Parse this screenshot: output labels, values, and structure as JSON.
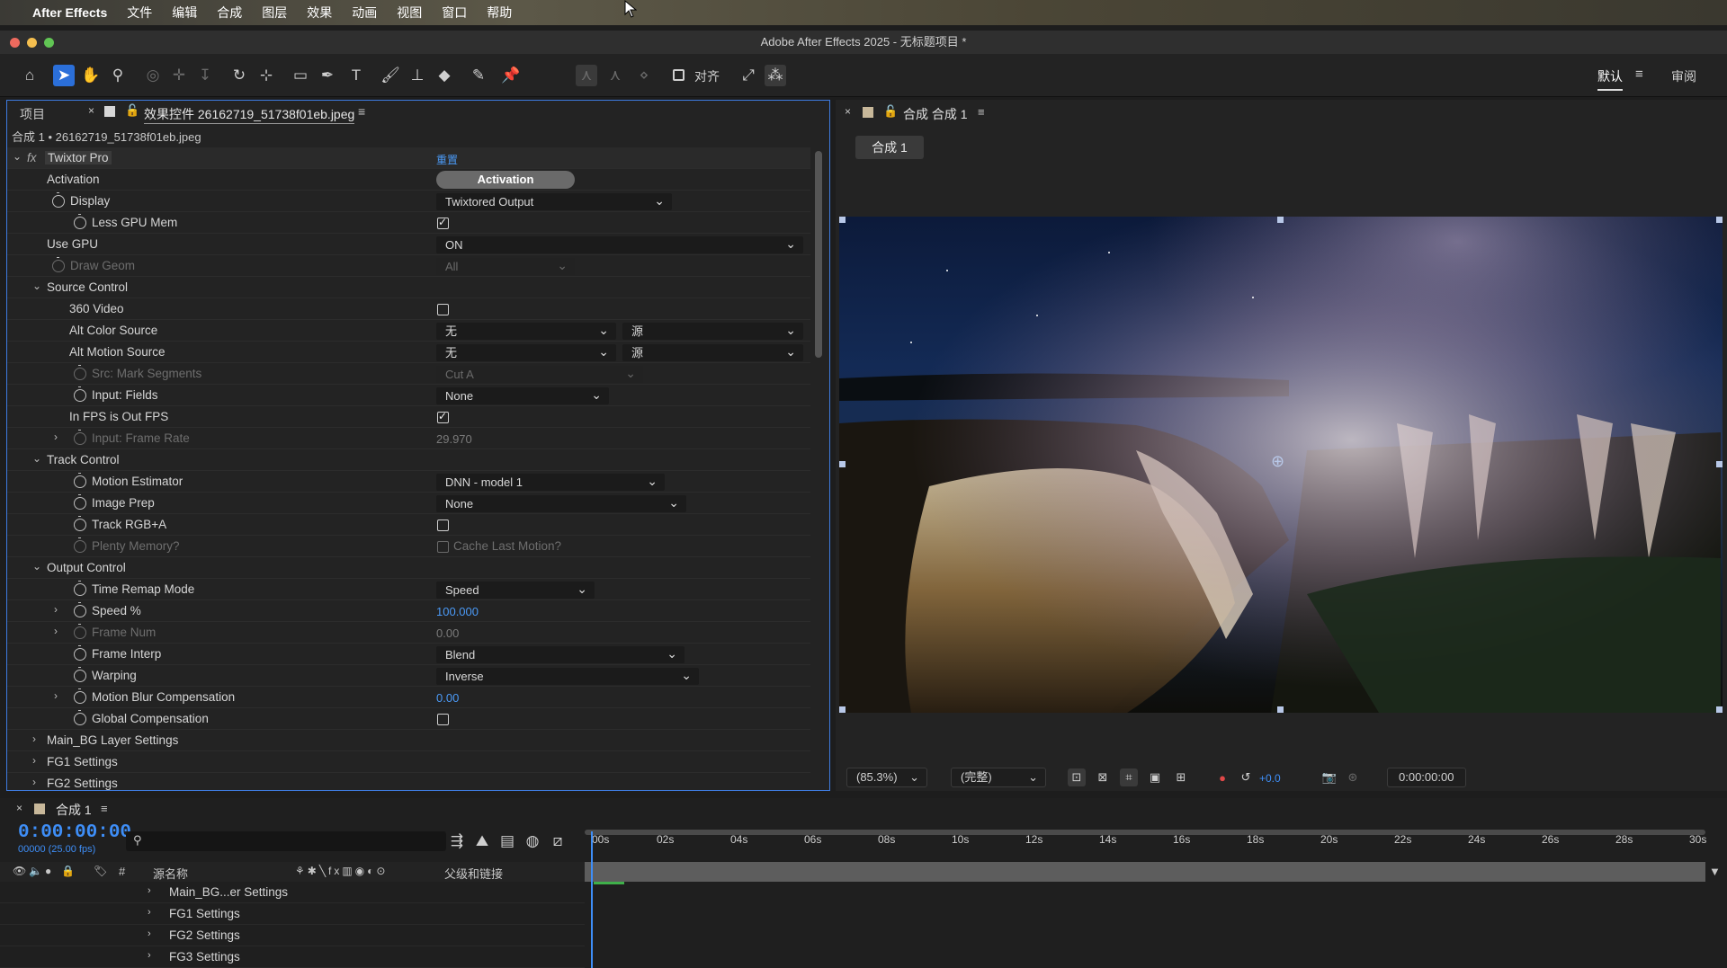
{
  "menubar": {
    "app": "After Effects",
    "items": [
      "文件",
      "编辑",
      "合成",
      "图层",
      "效果",
      "动画",
      "视图",
      "窗口",
      "帮助"
    ]
  },
  "titlebar": {
    "title": "Adobe After Effects 2025 - 无标题项目 *"
  },
  "toolbar": {
    "align_label": "对齐",
    "workspace_default": "默认",
    "workspace_review": "审阅"
  },
  "effect_controls": {
    "tab_project": "项目",
    "tab_effects": "效果控件 26162719_51738f01eb.jpeg",
    "subhead": "合成 1 • 26162719_51738f01eb.jpeg",
    "effect_name": "Twixtor Pro",
    "reset": "重置",
    "activation_label": "Activation",
    "activation_button": "Activation",
    "rows": {
      "display": "Display",
      "display_val": "Twixtored Output",
      "less_gpu": "Less GPU Mem",
      "use_gpu": "Use GPU",
      "use_gpu_val": "ON",
      "draw_geom": "Draw Geom",
      "draw_geom_val": "All",
      "source_control": "Source Control",
      "video360": "360 Video",
      "alt_color": "Alt Color Source",
      "alt_color_a": "无",
      "alt_color_b": "源",
      "alt_motion": "Alt Motion Source",
      "alt_motion_a": "无",
      "alt_motion_b": "源",
      "src_mark": "Src: Mark Segments",
      "src_mark_val": "Cut A",
      "input_fields": "Input: Fields",
      "input_fields_val": "None",
      "in_fps": "In FPS is Out FPS",
      "input_rate": "Input: Frame Rate",
      "input_rate_val": "29.970",
      "track_control": "Track Control",
      "motion_est": "Motion Estimator",
      "motion_est_val": "DNN - model 1",
      "image_prep": "Image Prep",
      "image_prep_val": "None",
      "track_rgba": "Track RGB+A",
      "plenty_mem": "Plenty Memory?",
      "cache_last": "Cache Last Motion?",
      "output_control": "Output Control",
      "time_remap": "Time Remap Mode",
      "time_remap_val": "Speed",
      "speed": "Speed %",
      "speed_val": "100.000",
      "frame_num": "Frame Num",
      "frame_num_val": "0.00",
      "frame_interp": "Frame Interp",
      "frame_interp_val": "Blend",
      "warping": "Warping",
      "warping_val": "Inverse",
      "mbc": "Motion Blur Compensation",
      "mbc_val": "0.00",
      "global_comp": "Global Compensation",
      "main_bg": "Main_BG Layer Settings",
      "fg1": "FG1 Settings",
      "fg2": "FG2 Settings"
    }
  },
  "composition": {
    "tab": "合成 合成 1",
    "chip": "合成 1",
    "zoom": "(85.3%)",
    "quality": "(完整)",
    "exposure": "+0.0",
    "timecode": "0:00:00:00"
  },
  "timeline": {
    "tab": "合成 1",
    "time": "0:00:00:00",
    "frames": "00000 (25.00 fps)",
    "col_source": "源名称",
    "col_parent": "父级和链接",
    "col_hash": "#",
    "layers": [
      "Main_BG...er Settings",
      "FG1 Settings",
      "FG2 Settings",
      "FG3 Settings"
    ],
    "ruler": [
      "00s",
      "02s",
      "04s",
      "06s",
      "08s",
      "10s",
      "12s",
      "14s",
      "16s",
      "18s",
      "20s",
      "22s",
      "24s",
      "26s",
      "28s",
      "30s"
    ]
  },
  "colors": {
    "accent": "#3e8ef7",
    "panel_border": "#3e7be0"
  }
}
